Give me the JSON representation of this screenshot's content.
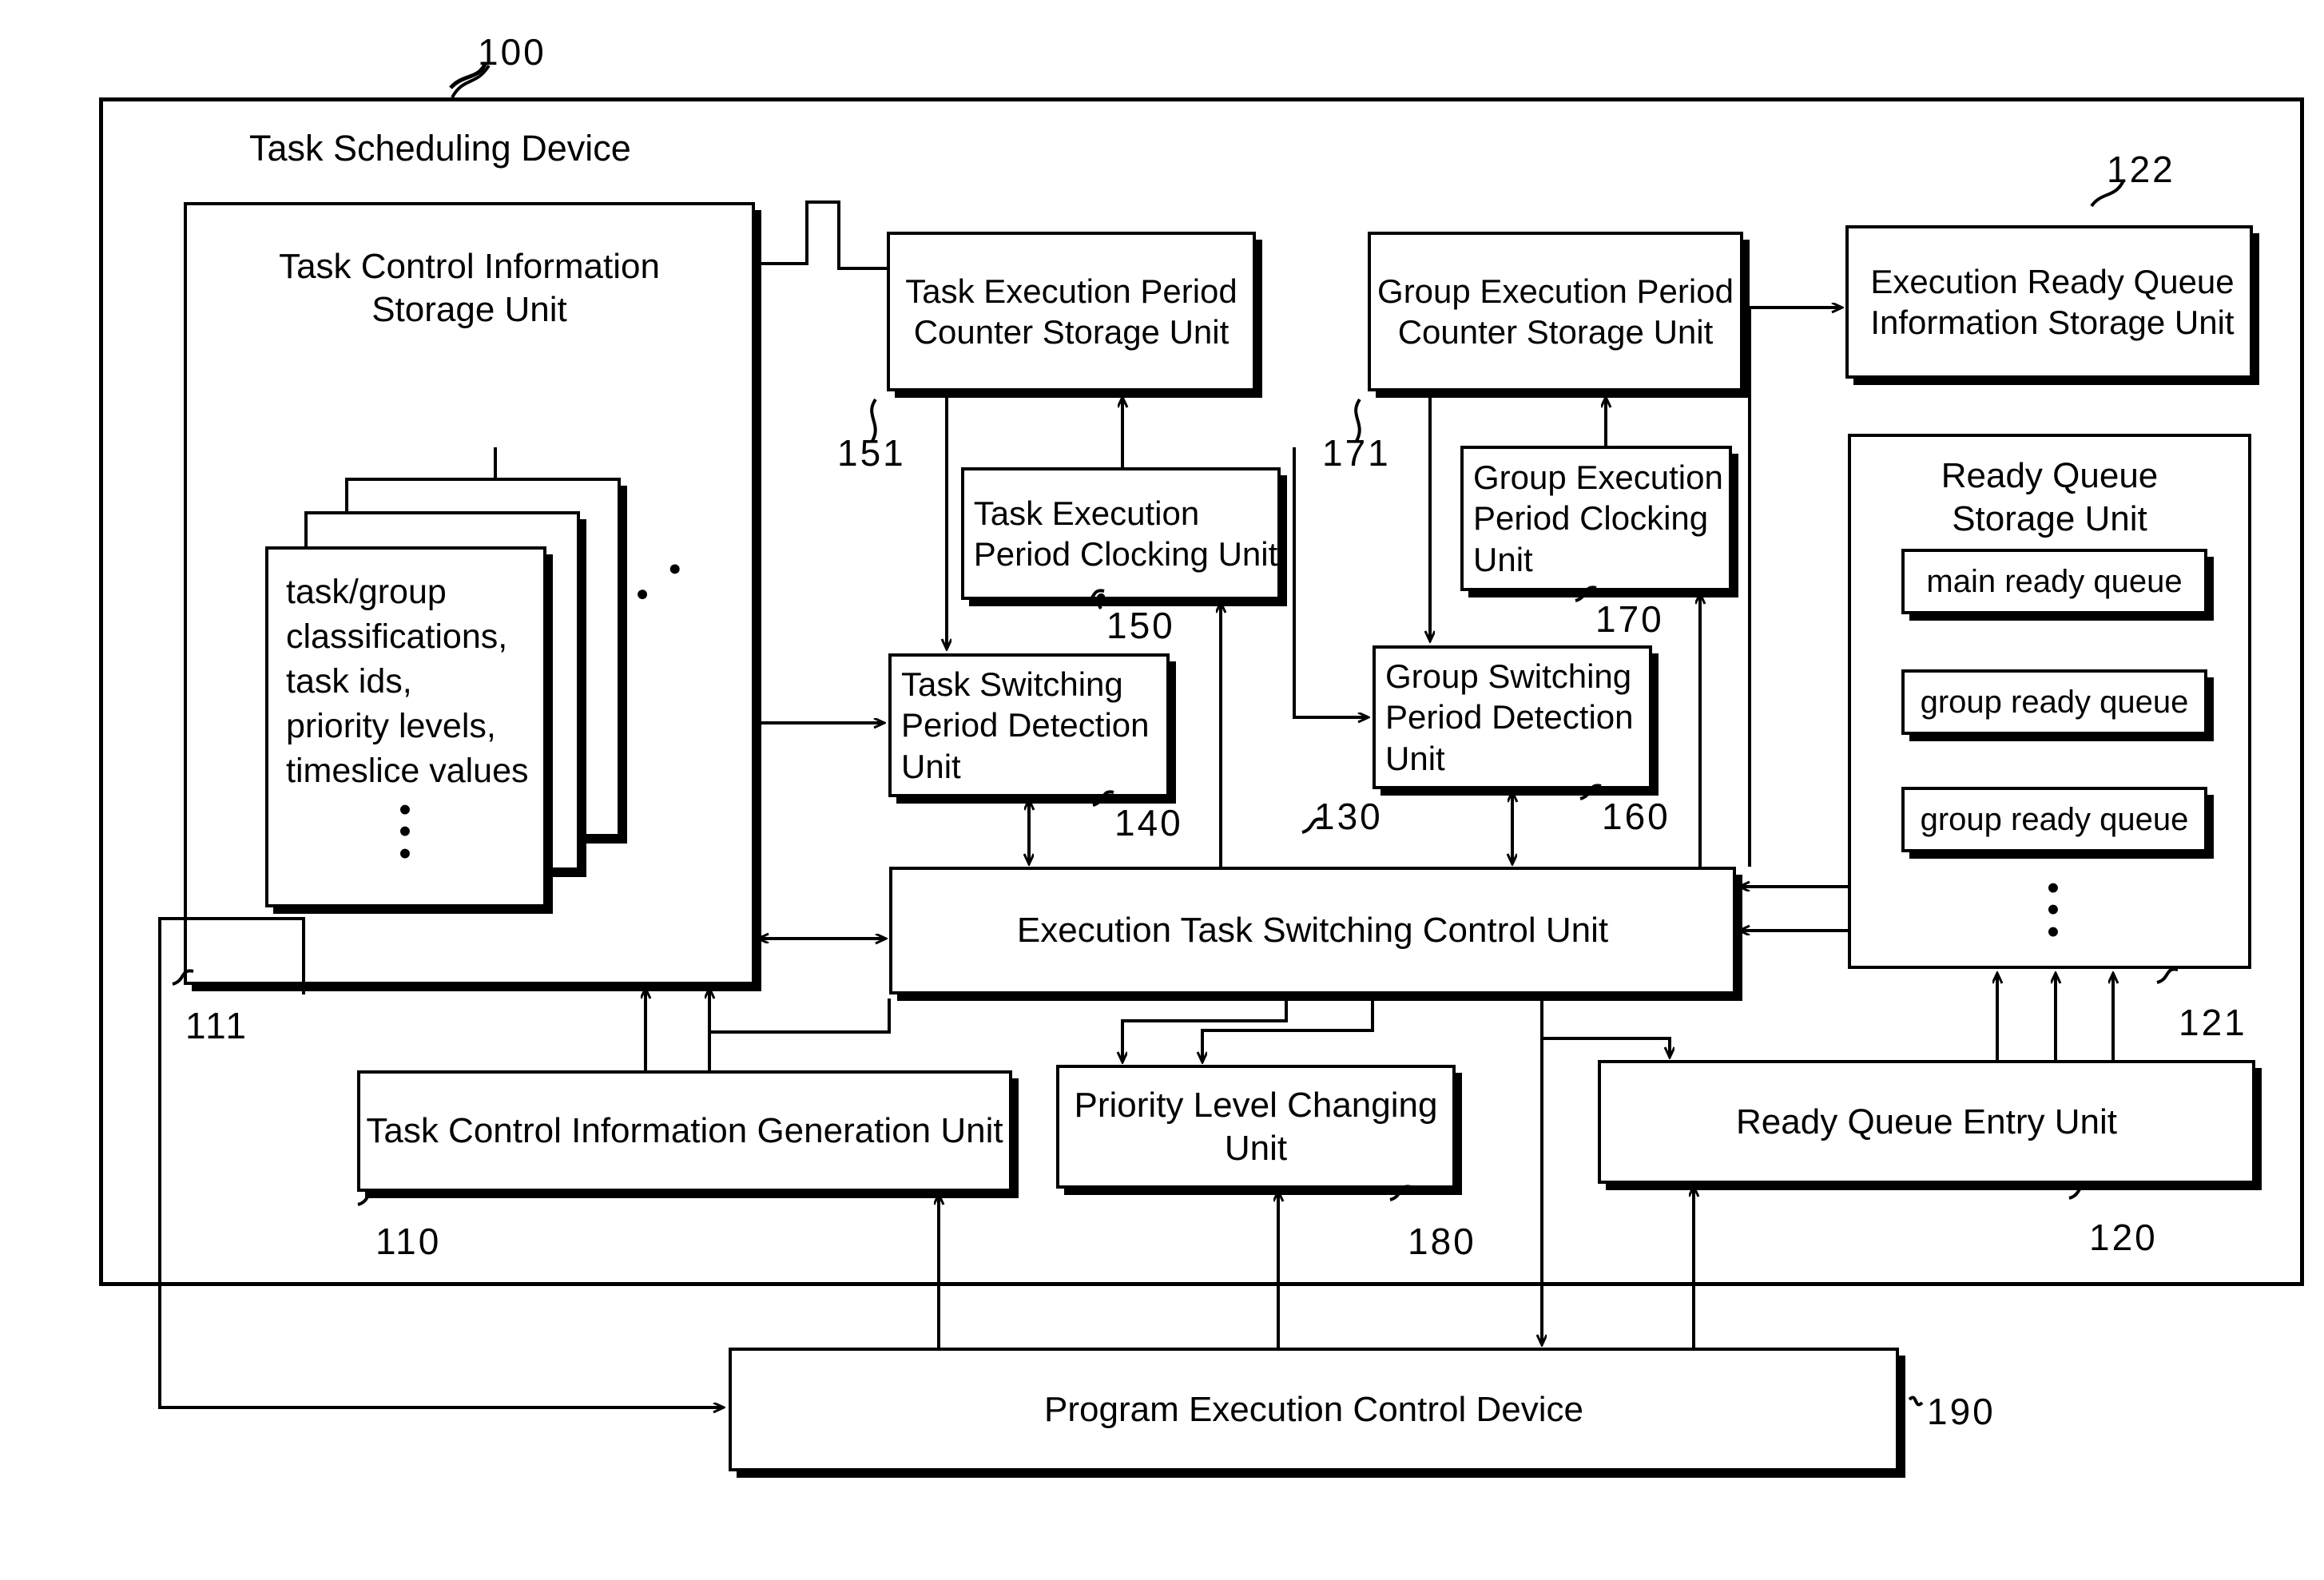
{
  "figure": {
    "device_label": "100",
    "device_title": "Task Scheduling Device",
    "program_device_label": "190"
  },
  "blocks": {
    "task_control_info_storage": {
      "title": "Task Control Information\nStorage Unit",
      "ref": "111",
      "card_text": "task/group\nclassifications,\ntask ids,\npriority levels,\ntimeslice values",
      "card_dots": "•\n•\n•",
      "stack_dots": "• •"
    },
    "task_exec_period_counter_storage": {
      "title": "Task Execution Period\nCounter Storage Unit",
      "ref": "151"
    },
    "task_exec_period_clocking": {
      "title": "Task Execution\nPeriod Clocking Unit",
      "ref": "150"
    },
    "task_switching_period_detection": {
      "title": "Task Switching\nPeriod Detection\nUnit",
      "ref": "140"
    },
    "group_exec_period_counter_storage": {
      "title": "Group Execution Period\nCounter Storage Unit",
      "ref": "171"
    },
    "group_exec_period_clocking": {
      "title": "Group Execution\nPeriod Clocking\nUnit",
      "ref": "170"
    },
    "group_switching_period_detection": {
      "title": "Group Switching\nPeriod Detection\nUnit",
      "ref": "160"
    },
    "execution_ready_queue_info_storage": {
      "title": "Execution Ready Queue\nInformation Storage Unit",
      "ref": "122"
    },
    "ready_queue_storage": {
      "title": "Ready Queue\nStorage Unit",
      "ref": "121",
      "queues": [
        "main ready queue",
        "group ready queue",
        "group ready queue"
      ],
      "queue_dots": "•\n•\n•"
    },
    "execution_task_switching_control": {
      "title": "Execution Task Switching Control Unit",
      "ref": "130"
    },
    "task_control_info_generation": {
      "title": "Task Control Information Generation Unit",
      "ref": "110"
    },
    "priority_level_changing": {
      "title": "Priority Level Changing\nUnit",
      "ref": "180"
    },
    "ready_queue_entry": {
      "title": "Ready Queue Entry Unit",
      "ref": "120"
    },
    "program_execution_control_device": {
      "title": "Program Execution Control Device",
      "ref": "190"
    }
  }
}
